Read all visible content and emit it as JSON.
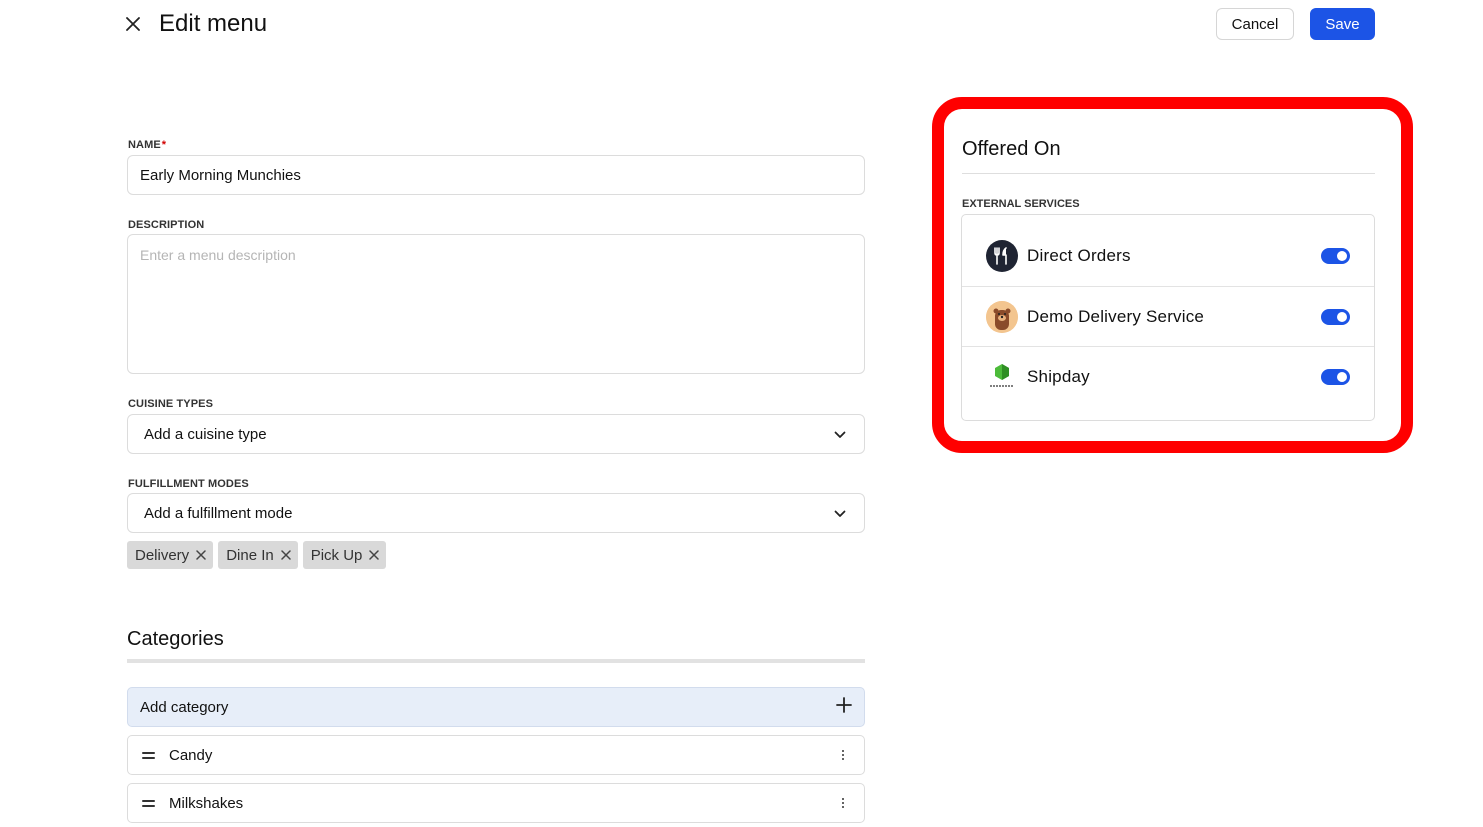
{
  "header": {
    "title": "Edit menu",
    "cancel_label": "Cancel",
    "save_label": "Save"
  },
  "form": {
    "name": {
      "label": "NAME",
      "required_mark": "*",
      "value": "Early Morning Munchies"
    },
    "description": {
      "label": "DESCRIPTION",
      "placeholder": "Enter a menu description"
    },
    "cuisine_types": {
      "label": "CUISINE TYPES",
      "placeholder": "Add a cuisine type"
    },
    "fulfillment_modes": {
      "label": "FULFILLMENT MODES",
      "placeholder": "Add a fulfillment mode",
      "chips": [
        "Delivery",
        "Dine In",
        "Pick Up"
      ]
    }
  },
  "categories": {
    "title": "Categories",
    "add_label": "Add category",
    "items": [
      "Candy",
      "Milkshakes"
    ]
  },
  "offered_on": {
    "title": "Offered On",
    "section_label": "EXTERNAL SERVICES",
    "services": [
      {
        "name": "Direct Orders",
        "enabled": true,
        "icon": "fork-knife-icon"
      },
      {
        "name": "Demo Delivery Service",
        "enabled": true,
        "icon": "bear-avatar-icon"
      },
      {
        "name": "Shipday",
        "enabled": true,
        "icon": "shipday-logo-icon"
      }
    ]
  },
  "colors": {
    "primary": "#1c54e6",
    "highlight": "#ff0000",
    "chip_bg": "#d9d9d9",
    "add_category_bg": "#e7eef9"
  }
}
